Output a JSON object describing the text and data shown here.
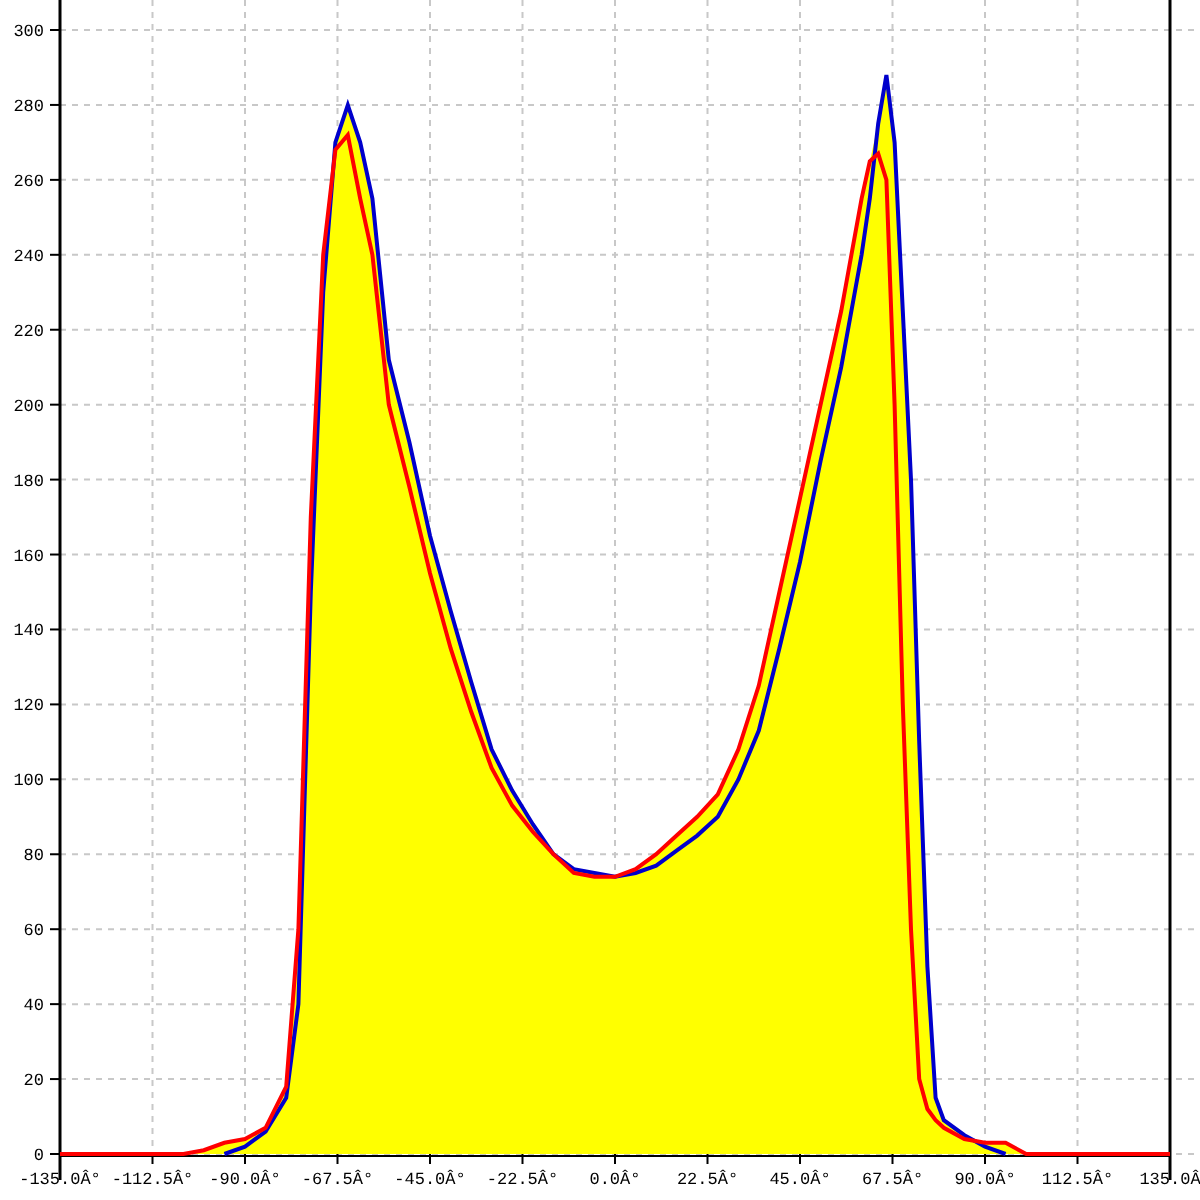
{
  "chart_data": {
    "type": "line",
    "grid": true,
    "x": [
      -135,
      -105,
      -100,
      -95,
      -90,
      -85,
      -80,
      -77,
      -74,
      -71,
      -68,
      -65,
      -62,
      -59,
      -55,
      -50,
      -45,
      -40,
      -35,
      -30,
      -25,
      -20,
      -15,
      -10,
      -5,
      0,
      5,
      10,
      15,
      20,
      25,
      30,
      35,
      40,
      45,
      50,
      55,
      60,
      62,
      64,
      66,
      68,
      70,
      72,
      74,
      76,
      78,
      80,
      85,
      90,
      95,
      100,
      105,
      135
    ],
    "series": [
      {
        "type": "area",
        "color": "#ffff00",
        "values": [
          0,
          0,
          1,
          3,
          4,
          7,
          18,
          60,
          170,
          240,
          270,
          280,
          270,
          255,
          212,
          190,
          165,
          145,
          126,
          108,
          97,
          88,
          80,
          76,
          75,
          74,
          76,
          80,
          85,
          90,
          96,
          108,
          125,
          150,
          175,
          200,
          225,
          255,
          265,
          275,
          288,
          270,
          225,
          180,
          110,
          50,
          15,
          9,
          5,
          3,
          3,
          0,
          0,
          0
        ]
      },
      {
        "type": "line",
        "color": "#0000cc",
        "values": [
          null,
          null,
          null,
          0,
          2,
          6,
          15,
          40,
          150,
          230,
          270,
          280,
          270,
          255,
          212,
          190,
          165,
          145,
          126,
          108,
          97,
          88,
          80,
          76,
          75,
          74,
          75,
          77,
          81,
          85,
          90,
          100,
          113,
          135,
          158,
          185,
          210,
          240,
          255,
          275,
          288,
          270,
          225,
          180,
          110,
          50,
          15,
          9,
          5,
          2,
          0,
          null,
          null,
          null
        ]
      },
      {
        "type": "line",
        "color": "#ff0000",
        "values": [
          0,
          0,
          1,
          3,
          4,
          7,
          18,
          60,
          170,
          240,
          268,
          272,
          255,
          240,
          200,
          178,
          155,
          135,
          118,
          103,
          93,
          86,
          80,
          75,
          74,
          74,
          76,
          80,
          85,
          90,
          96,
          108,
          125,
          150,
          175,
          200,
          225,
          255,
          265,
          267,
          260,
          200,
          120,
          60,
          20,
          12,
          9,
          7,
          4,
          3,
          3,
          0,
          0,
          0
        ]
      }
    ],
    "xlim": [
      -135,
      135
    ],
    "ylim": [
      0,
      300
    ],
    "xticks": [
      {
        "value": -135,
        "label": "-135.0Â°"
      },
      {
        "value": -112.5,
        "label": "-112.5Â°"
      },
      {
        "value": -90,
        "label": "-90.0Â°"
      },
      {
        "value": -67.5,
        "label": "-67.5Â°"
      },
      {
        "value": -45,
        "label": "-45.0Â°"
      },
      {
        "value": -22.5,
        "label": "-22.5Â°"
      },
      {
        "value": 0,
        "label": "0.0Â°"
      },
      {
        "value": 22.5,
        "label": "22.5Â°"
      },
      {
        "value": 45,
        "label": "45.0Â°"
      },
      {
        "value": 67.5,
        "label": "67.5Â°"
      },
      {
        "value": 90,
        "label": "90.0Â°"
      },
      {
        "value": 112.5,
        "label": "112.5Â°"
      },
      {
        "value": 135,
        "label": "135.0Â"
      }
    ],
    "yticks": [
      0,
      20,
      40,
      60,
      80,
      100,
      120,
      140,
      160,
      180,
      200,
      220,
      240,
      260,
      280,
      300
    ]
  }
}
